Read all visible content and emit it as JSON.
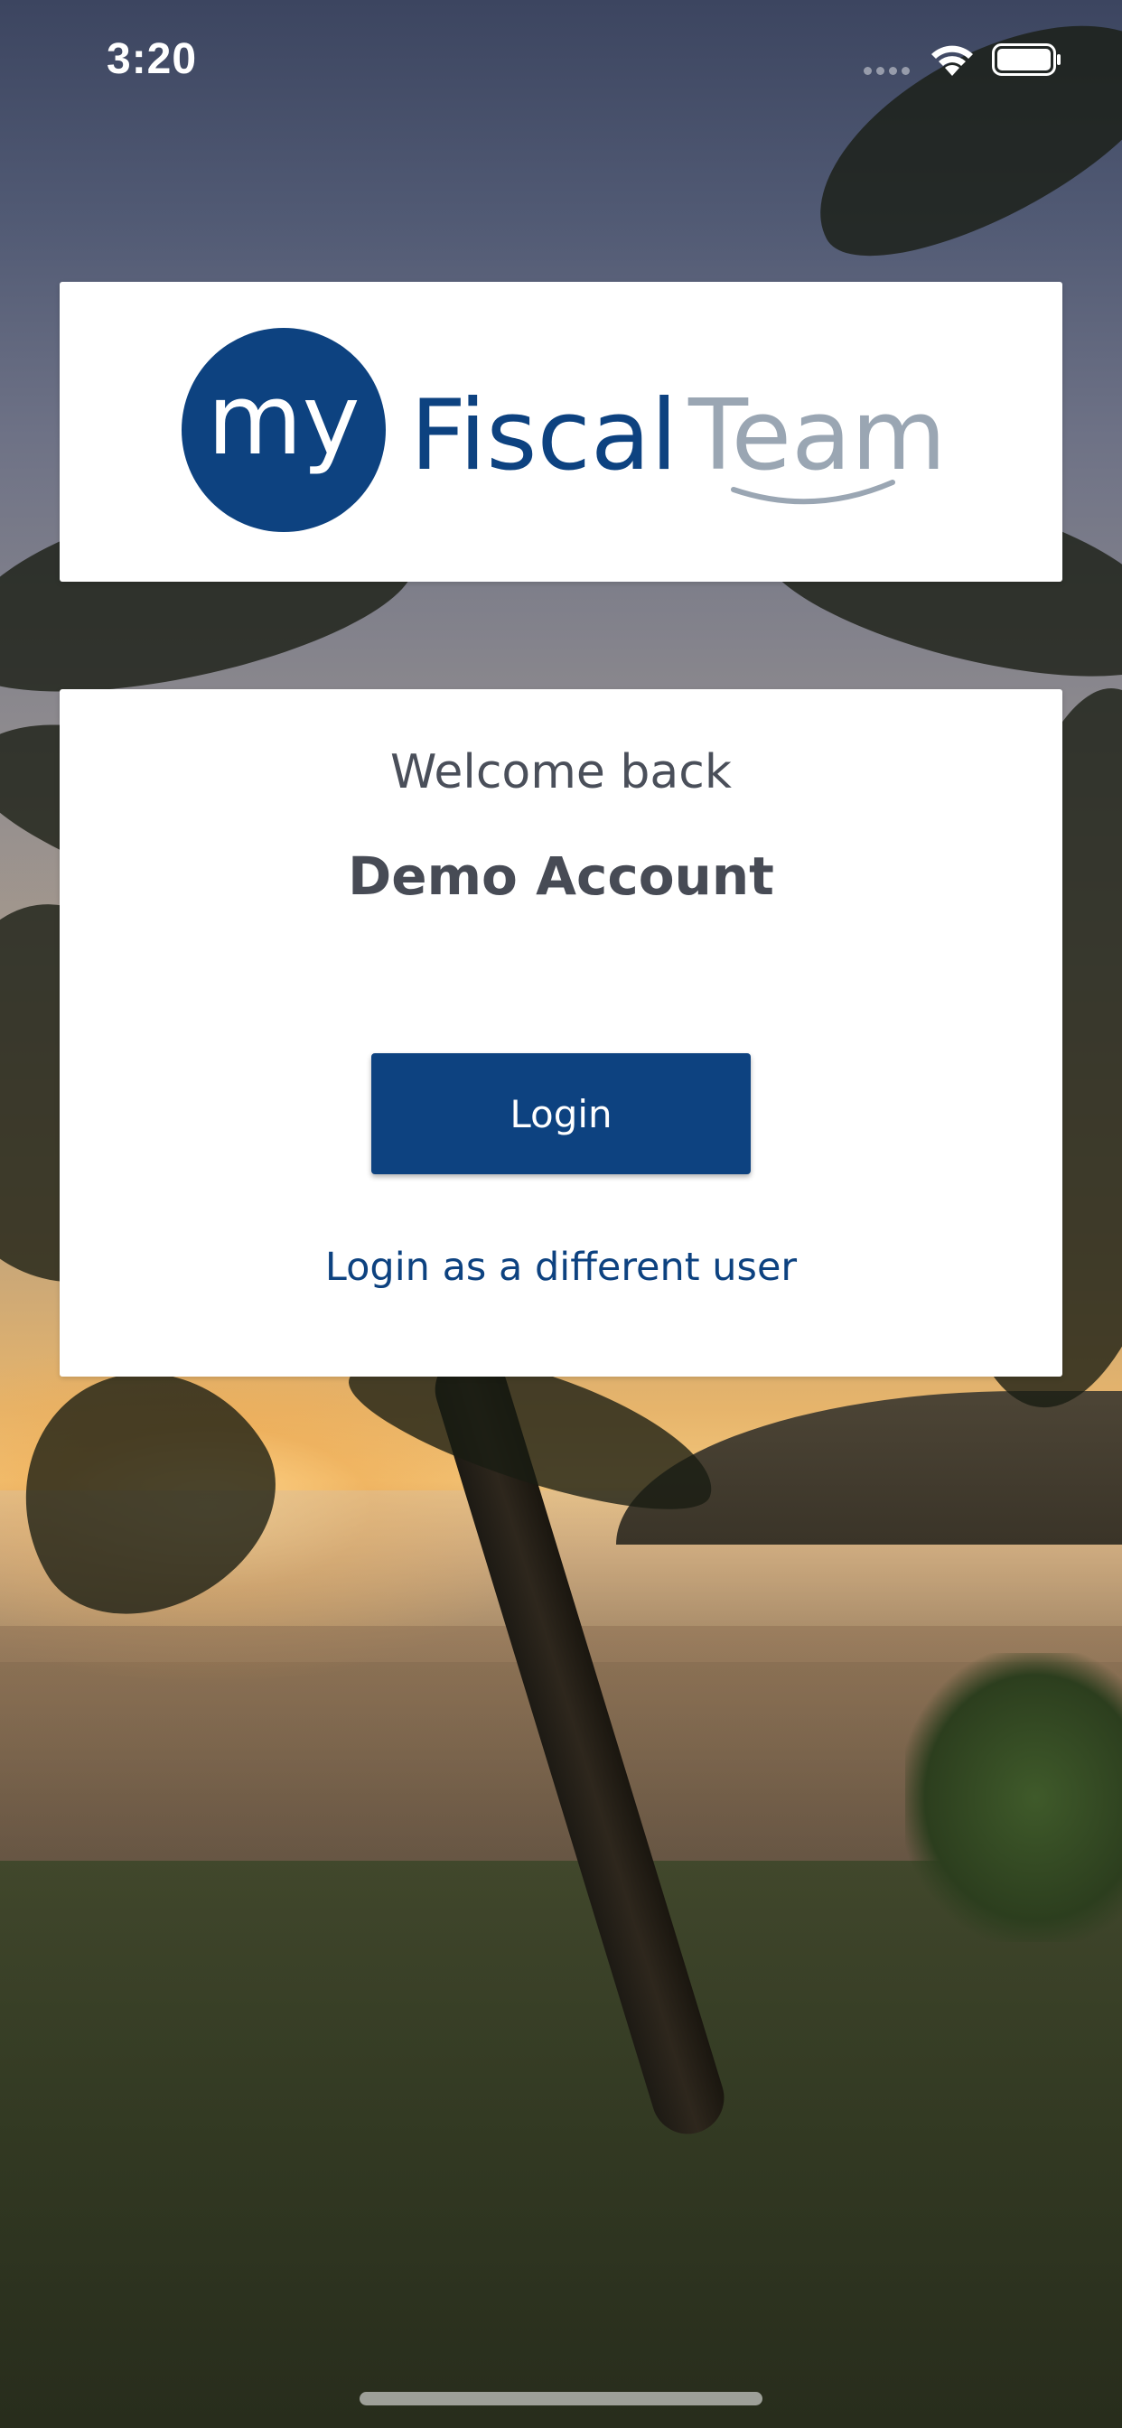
{
  "status_bar": {
    "time": "3:20",
    "icons": [
      "cellular-signal-icon",
      "wifi-icon",
      "battery-icon"
    ]
  },
  "logo": {
    "my": "my",
    "fiscal": "Fiscal",
    "team": "Team",
    "colors": {
      "navy": "#0d4280",
      "grey": "#9aa6b3"
    }
  },
  "welcome": {
    "greeting": "Welcome back",
    "account_name": "Demo Account",
    "login_label": "Login",
    "alt_login_label": "Login as a different user"
  },
  "colors": {
    "accent": "#0d4280",
    "text_dark": "#474b55",
    "card_bg": "#ffffff"
  }
}
